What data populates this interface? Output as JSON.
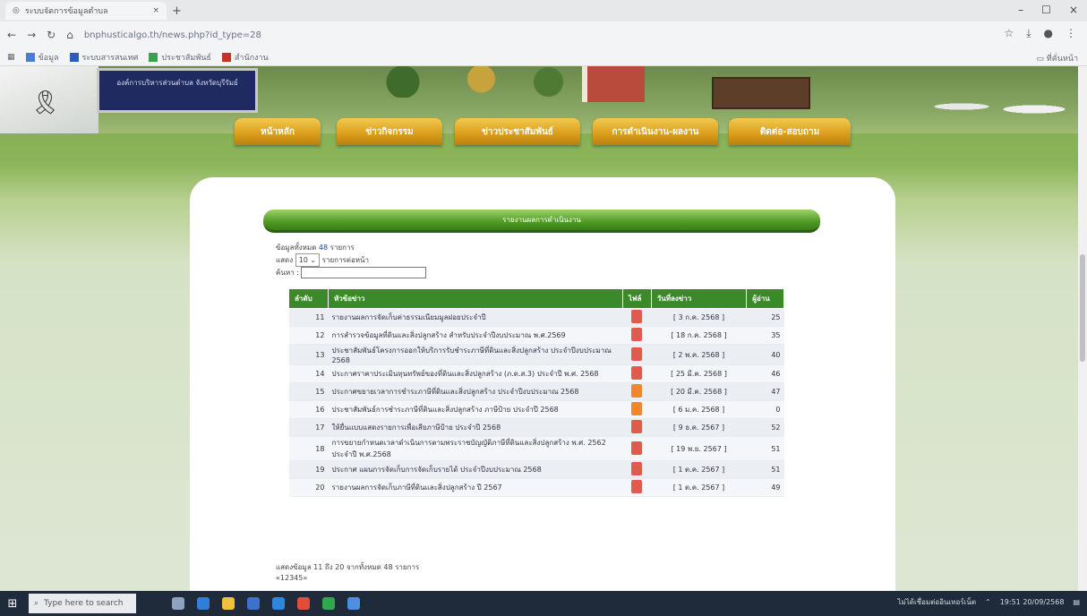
{
  "browser": {
    "tab_title": "ระบบจัดการข้อมูลตำบล",
    "new_tab": "+",
    "url": "bnphusticalgo.th/news.php?id_type=28",
    "window_controls": [
      "–",
      "☐",
      "×"
    ],
    "bookmarks": [
      "ข้อมูล",
      "ระบบสารสนเทศ",
      "ประชาสัมพันธ์",
      "สำนักงาน"
    ],
    "bookmarks_right": "▭ ที่คั่นหน้า"
  },
  "banner": {
    "sign_text": "องค์การบริหารส่วนตำบล จังหวัดบุรีรัมย์"
  },
  "nav": {
    "items": [
      "หน้าหลัก",
      "ข่าวกิจกรรม",
      "ข่าวประชาสัมพันธ์",
      "การดำเนินงาน-ผลงาน",
      "ติดต่อ-สอบถาม"
    ]
  },
  "section": {
    "title": "รายงานผลการดำเนินงาน"
  },
  "list_info": {
    "total_label": "ข้อมูลทั้งหมด",
    "total_count": "48",
    "total_unit": "รายการ",
    "show_label": "แสดง",
    "per_page_value": "10",
    "per_page_suffix": "รายการต่อหน้า",
    "search_label": "ค้นหา :"
  },
  "table": {
    "headers": [
      "ลำดับ",
      "หัวข้อข่าว",
      "ไฟล์",
      "วันที่ลงข่าว",
      "ผู้อ่าน"
    ],
    "rows": [
      {
        "num": "11",
        "title": "รายงานผลการจัดเก็บค่าธรรมเนียมมูลฝอยประจำปี",
        "file": "pdf",
        "date": "[ 3 ก.ค. 2568 ]",
        "reads": "25"
      },
      {
        "num": "12",
        "title": "การสำรวจข้อมูลที่ดินและสิ่งปลูกสร้าง สำหรับประจำปีงบประมาณ พ.ศ.2569",
        "file": "pdf",
        "date": "[ 18 ก.ค. 2568 ]",
        "reads": "35"
      },
      {
        "num": "13",
        "title": "ประชาสัมพันธ์โครงการออกให้บริการรับชำระภาษีที่ดินและสิ่งปลูกสร้าง ประจำปีงบประมาณ 2568",
        "file": "pdf",
        "date": "[ 2 พ.ค. 2568 ]",
        "reads": "40"
      },
      {
        "num": "14",
        "title": "ประกาศราคาประเมินทุนทรัพย์ของที่ดินและสิ่งปลูกสร้าง (ภ.ด.ส.3) ประจำปี พ.ศ. 2568",
        "file": "pdf",
        "date": "[ 25 มี.ค. 2568 ]",
        "reads": "46"
      },
      {
        "num": "15",
        "title": "ประกาศขยายเวลาการชำระภาษีที่ดินและสิ่งปลูกสร้าง ประจำปีงบประมาณ 2568",
        "file": "doc",
        "date": "[ 20 มี.ค. 2568 ]",
        "reads": "47"
      },
      {
        "num": "16",
        "title": "ประชาสัมพันธ์การชำระภาษีที่ดินและสิ่งปลูกสร้าง ภาษีป้าย ประจำปี 2568",
        "file": "doc",
        "date": "[ 6 ม.ค. 2568 ]",
        "reads": "0"
      },
      {
        "num": "17",
        "title": "ให้ยื่นแบบแสดงรายการเพื่อเสียภาษีป้าย ประจำปี 2568",
        "file": "pdf",
        "date": "[ 9 ธ.ค. 2567 ]",
        "reads": "52"
      },
      {
        "num": "18",
        "title": "การขยายกำหนดเวลาดำเนินการตามพระราชบัญญัติภาษีที่ดินและสิ่งปลูกสร้าง พ.ศ. 2562 ประจำปี พ.ศ.2568",
        "file": "pdf",
        "date": "[ 19 พ.ย. 2567 ]",
        "reads": "51"
      },
      {
        "num": "19",
        "title": "ประกาศ แผนการจัดเก็บการจัดเก็บรายได้ ประจำปีงบประมาณ 2568",
        "file": "pdf",
        "date": "[ 1 ต.ค. 2567 ]",
        "reads": "51"
      },
      {
        "num": "20",
        "title": "รายงานผลการจัดเก็บภาษีที่ดินและสิ่งปลูกสร้าง ปี 2567",
        "file": "pdf",
        "date": "[ 1 ต.ค. 2567 ]",
        "reads": "49"
      }
    ]
  },
  "footer": {
    "summary": "แสดงข้อมูล 11 ถึง 20 จากทั้งหมด 48 รายการ",
    "pagination": "«12345»"
  },
  "taskbar": {
    "search_placeholder": "Type here to search",
    "tray_text": "ไม่ได้เชื่อมต่ออินเทอร์เน็ต",
    "time": "19:51",
    "date": "20/09/2568"
  }
}
